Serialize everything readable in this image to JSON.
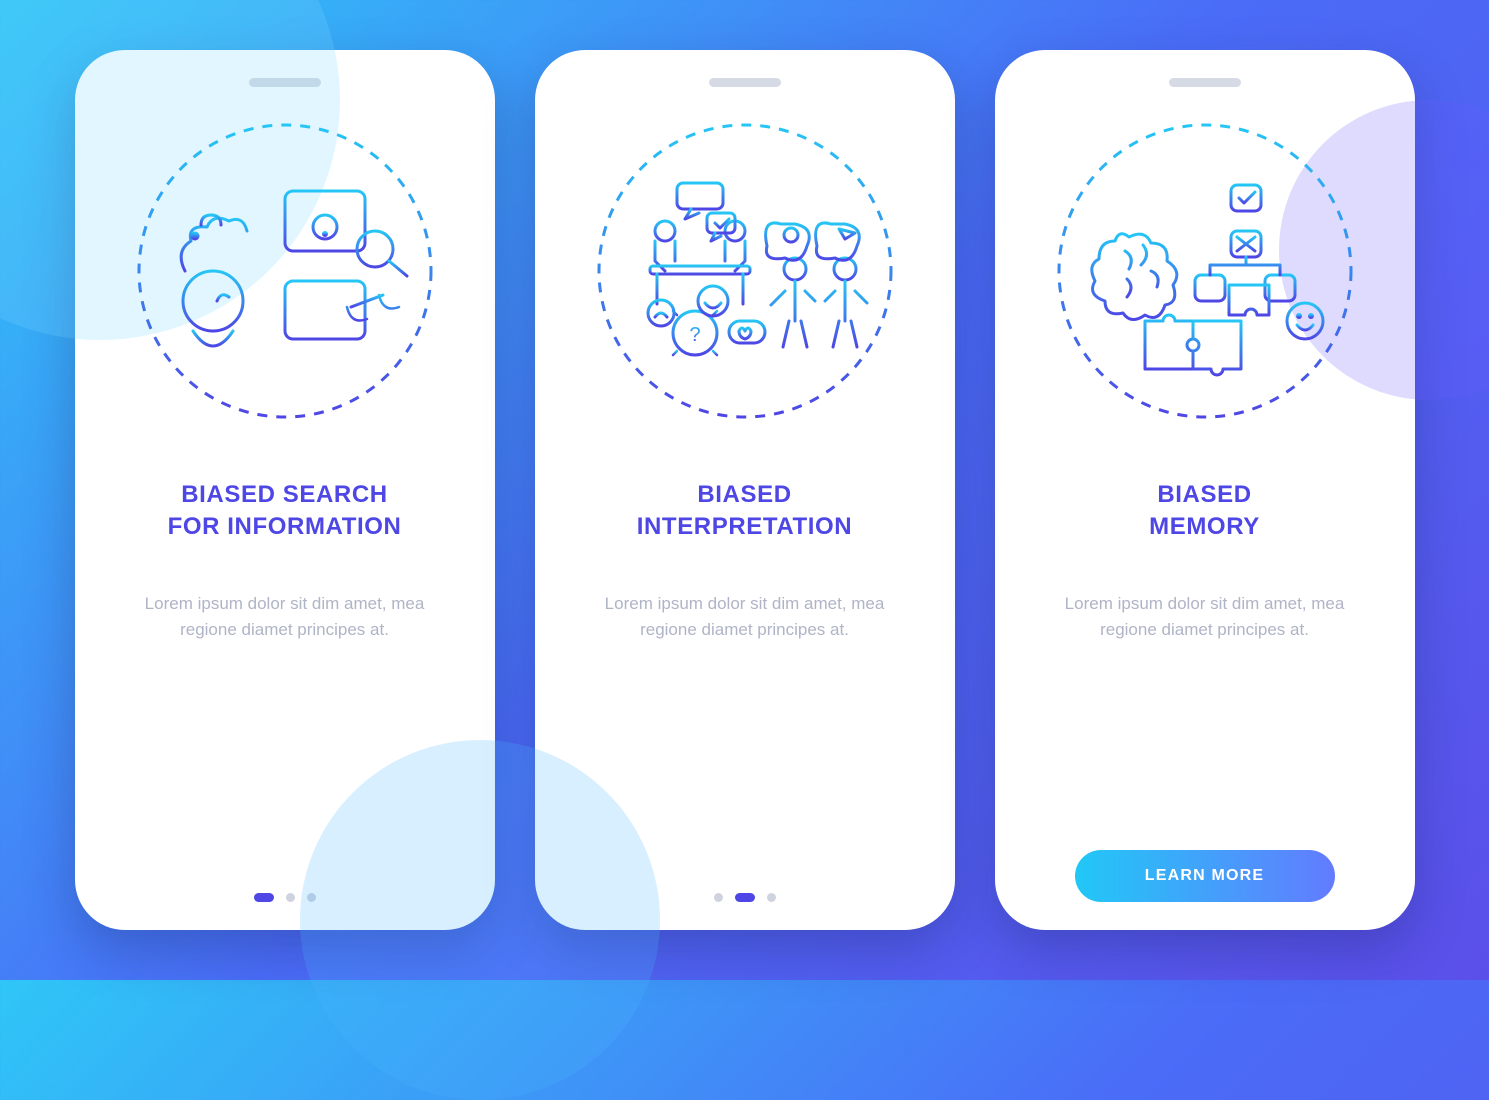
{
  "screens": [
    {
      "title": "BIASED SEARCH\nFOR INFORMATION",
      "description": "Lorem ipsum dolor sit dim amet, mea regione diamet principes at.",
      "icon_name": "search-information-icon",
      "active_dot": 0,
      "has_button": false
    },
    {
      "title": "BIASED\nINTERPRETATION",
      "description": "Lorem ipsum dolor sit dim amet, mea regione diamet principes at.",
      "icon_name": "interpretation-icon",
      "active_dot": 1,
      "has_button": false
    },
    {
      "title": "BIASED\nMEMORY",
      "description": "Lorem ipsum dolor sit dim amet, mea regione diamet principes at.",
      "icon_name": "memory-icon",
      "active_dot": 2,
      "has_button": true
    }
  ],
  "ui": {
    "button_label": "LEARN MORE",
    "dot_count": 3
  },
  "colors": {
    "title": "#4E46E5",
    "desc": "#AFB4C6",
    "gradient_start": "#21C8F6",
    "gradient_end": "#637BFF"
  }
}
